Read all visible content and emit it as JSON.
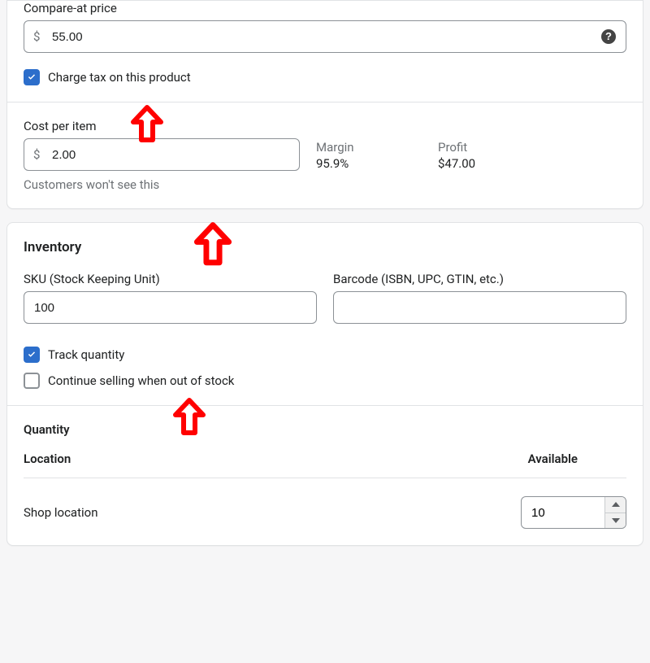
{
  "pricing": {
    "compare_at_label": "Compare-at price",
    "compare_at_value": "55.00",
    "currency_prefix": "$",
    "help_icon": "help-circle-icon",
    "charge_tax_label": "Charge tax on this product",
    "charge_tax_checked": true,
    "cost_label": "Cost per item",
    "cost_value": "2.00",
    "cost_helper": "Customers won't see this",
    "margin_label": "Margin",
    "margin_value": "95.9%",
    "profit_label": "Profit",
    "profit_value": "$47.00"
  },
  "inventory": {
    "title": "Inventory",
    "sku_label": "SKU (Stock Keeping Unit)",
    "sku_value": "100",
    "barcode_label": "Barcode (ISBN, UPC, GTIN, etc.)",
    "barcode_value": "",
    "track_label": "Track quantity",
    "track_checked": true,
    "oversell_label": "Continue selling when out of stock",
    "oversell_checked": false,
    "quantity_subtitle": "Quantity",
    "col_location": "Location",
    "col_available": "Available",
    "location_name": "Shop location",
    "available_value": "10"
  },
  "annotations": {
    "arrow_color": "#ff0000"
  }
}
